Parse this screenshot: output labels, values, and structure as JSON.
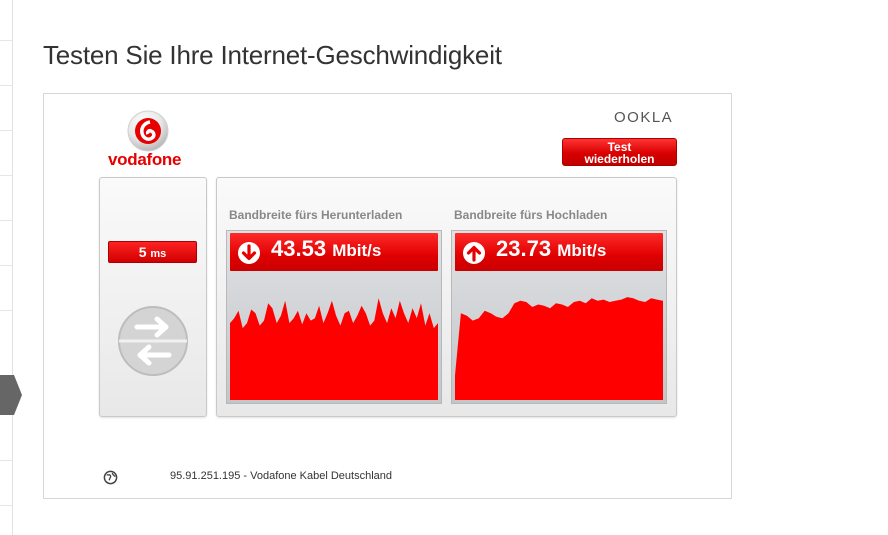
{
  "page": {
    "title": "Testen Sie Ihre Internet-Geschwindigkeit"
  },
  "brand": {
    "name": "vodafone",
    "provider_mark": "OOKLA",
    "accent_color": "#e60000"
  },
  "controls": {
    "retest_line1": "Test",
    "retest_line2": "wiederholen"
  },
  "ping": {
    "value": "5",
    "unit": "ms"
  },
  "download": {
    "label": "Bandbreite fürs Herunterladen",
    "value": "43.53",
    "unit": "Mbit/s",
    "icon": "arrow-down-icon",
    "samples": [
      0.62,
      0.66,
      0.72,
      0.58,
      0.62,
      0.73,
      0.7,
      0.6,
      0.64,
      0.78,
      0.74,
      0.62,
      0.68,
      0.8,
      0.62,
      0.66,
      0.72,
      0.61,
      0.7,
      0.64,
      0.66,
      0.76,
      0.62,
      0.7,
      0.8,
      0.68,
      0.6,
      0.7,
      0.72,
      0.62,
      0.68,
      0.76,
      0.7,
      0.6,
      0.64,
      0.82,
      0.7,
      0.62,
      0.74,
      0.66,
      0.8,
      0.7,
      0.62,
      0.74,
      0.66,
      0.78,
      0.6,
      0.7,
      0.58,
      0.62
    ]
  },
  "upload": {
    "label": "Bandbreite fürs Hochladen",
    "value": "23.73",
    "unit": "Mbit/s",
    "icon": "arrow-up-icon",
    "samples": [
      0.2,
      0.7,
      0.68,
      0.64,
      0.66,
      0.72,
      0.7,
      0.67,
      0.66,
      0.7,
      0.78,
      0.8,
      0.79,
      0.75,
      0.77,
      0.76,
      0.74,
      0.78,
      0.77,
      0.75,
      0.79,
      0.8,
      0.78,
      0.82,
      0.8,
      0.81,
      0.79,
      0.8,
      0.81,
      0.83,
      0.82,
      0.8,
      0.79,
      0.82,
      0.81,
      0.8
    ]
  },
  "footer": {
    "text": "95.91.251.195 - Vodafone Kabel Deutschland",
    "icon": "globe-icon"
  }
}
